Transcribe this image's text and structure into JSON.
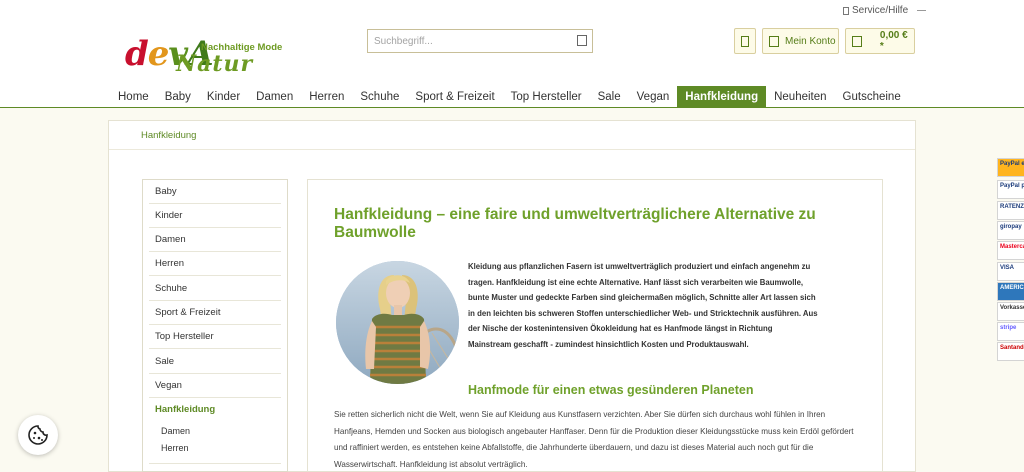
{
  "header": {
    "service_link": "Service/Hilfe",
    "logo": {
      "word1_parts": [
        "d",
        "e",
        "v",
        "A"
      ],
      "word2": "Natur",
      "tagline": "Nachhaltige Mode"
    },
    "search": {
      "placeholder": "Suchbegriff..."
    },
    "account_label": "Mein Konto",
    "cart_total": "0,00 € *"
  },
  "nav": {
    "active_index": 10,
    "items": [
      "Home",
      "Baby",
      "Kinder",
      "Damen",
      "Herren",
      "Schuhe",
      "Sport & Freizeit",
      "Top Hersteller",
      "Sale",
      "Vegan",
      "Hanfkleidung",
      "Neuheiten",
      "Gutscheine"
    ]
  },
  "breadcrumb": "Hanfkleidung",
  "sidebar": {
    "items": [
      "Baby",
      "Kinder",
      "Damen",
      "Herren",
      "Schuhe",
      "Sport & Freizeit",
      "Top Hersteller",
      "Sale",
      "Vegan",
      "Hanfkleidung"
    ],
    "active_index": 9,
    "subitems": [
      "Damen",
      "Herren"
    ]
  },
  "content": {
    "title": "Hanfkleidung – eine faire und umweltverträglichere Alternative zu Baumwolle",
    "intro": "Kleidung aus pflanzlichen Fasern ist umweltverträglich produziert und einfach angenehm zu tragen. Hanfkleidung ist eine echte Alternative. Hanf lässt sich verarbeiten wie Baumwolle, bunte Muster und gedeckte Farben sind gleichermaßen möglich, Schnitte aller Art lassen sich in den leichten bis schweren Stoffen unterschiedlicher Web- und Stricktechnik ausführen. Aus der Nische der kostenintensiven Ökokleidung hat es Hanfmode längst in Richtung Mainstream geschafft - zumindest hinsichtlich Kosten und Produktauswahl.",
    "subtitle": "Hanfmode für einen etwas gesünderen Planeten",
    "body": "Sie retten sicherlich nicht die Welt, wenn Sie auf Kleidung aus Kunstfasern verzichten. Aber Sie dürfen sich durchaus wohl fühlen in Ihren Hanfjeans, Hemden und Socken aus biologisch angebauter Hanffaser. Denn für die Produktion dieser Kleidungsstücke muss kein Erdöl gefördert und raffiniert werden, es entstehen keine Abfallstoffe, die Jahrhunderte überdauern, und dazu ist dieses Material auch noch gut für die Wasserwirtschaft. Hanfkleidung ist absolut verträglich."
  },
  "payment_badges": [
    "PayPal express",
    "PayPal plus",
    "RATENZAHLUNG",
    "giropay",
    "Mastercard",
    "VISA",
    "AMERICAN EXPRESS",
    "Vorkasse",
    "stripe",
    "Santander RECHNUNG"
  ],
  "colors": {
    "brand_green": "#5e8a25",
    "heading_green": "#6fa12b",
    "page_bg": "#fbfaf1"
  }
}
